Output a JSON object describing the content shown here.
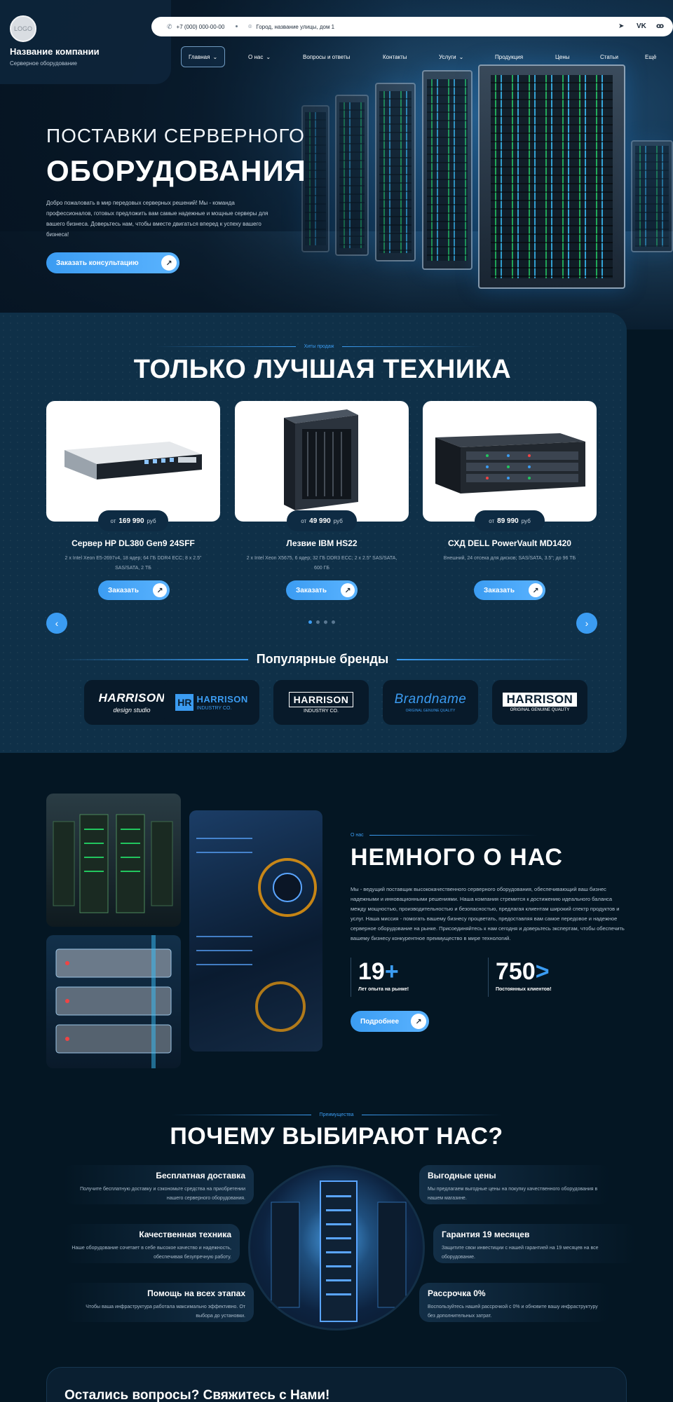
{
  "brand": {
    "logo_text": "LOGO",
    "company_name": "Название компании",
    "company_sub": "Серверное оборудование"
  },
  "topbar": {
    "phone": "+7 (000) 000-00-00",
    "address": "Город, название улицы, дом 1",
    "phone_icon": "phone-icon",
    "map_icon": "map-pin-icon",
    "social": [
      "telegram-icon",
      "vk-icon",
      "odnoklassniki-icon"
    ]
  },
  "nav": {
    "items": [
      "Главная",
      "О нас",
      "Вопросы и ответы",
      "Контакты",
      "Услуги",
      "Продукция",
      "Цены",
      "Статьи",
      "Ещё"
    ]
  },
  "hero": {
    "title_line1": "ПОСТАВКИ СЕРВЕРНОГО",
    "title_line2": "ОБОРУДОВАНИЯ",
    "description": "Добро пожаловать в мир передовых серверных решений! Мы - команда профессионалов, готовых предложить вам самые надежные и мощные серверы для вашего бизнеса. Доверьтесь нам, чтобы вместе двигаться вперед к успеху вашего бизнеса!",
    "cta": "Заказать консультацию"
  },
  "products": {
    "eyebrow": "Хиты продаж",
    "title": "ТОЛЬКО ЛУЧШАЯ ТЕХНИКА",
    "from_label": "от",
    "currency": "руб",
    "order_label": "Заказать",
    "items": [
      {
        "price": "169 990",
        "name": "Сервер HP DL380 Gen9 24SFF",
        "spec": "2 x Intel Xeon E5-2697v4, 18 ядер; 64 ГБ DDR4 ECC; 8 x 2.5\" SAS/SATA, 2 ТБ"
      },
      {
        "price": "49 990",
        "name": "Лезвие IBM HS22",
        "spec": "2 x Intel Xeon X5675, 6 ядер; 32 ГБ DDR3 ECC; 2 x 2.5\" SAS/SATA, 600 ГБ"
      },
      {
        "price": "89 990",
        "name": "СХД DELL PowerVault MD1420",
        "spec": "Внешний, 24 отсека для дисков; SAS/SATA, 3.5\"; до 96 ТБ"
      }
    ],
    "slide_count": 4,
    "active_slide": 1
  },
  "brands": {
    "title": "Популярные бренды",
    "items": [
      {
        "main": "HARRISON",
        "sub": "design studio"
      },
      {
        "main": "HARRISON",
        "sub": "INDUSTRY CO.",
        "badge": "HR"
      },
      {
        "main": "HARRISON",
        "sub": "INDUSTRY CO."
      },
      {
        "main": "Brandname",
        "sub": "ORIGINAL GENUINE QUALITY"
      },
      {
        "main": "HARRISON",
        "sub": "ORIGINAL GENUINE QUALITY"
      }
    ]
  },
  "about": {
    "eyebrow": "О нас",
    "title": "НЕМНОГО О НАС",
    "text": "Мы - ведущий поставщик высококачественного серверного оборудования, обеспечивающий ваш бизнес надежными и инновационными решениями. Наша компания стремится к достижению идеального баланса между мощностью, производительностью и безопасностью, предлагая клиентам широкий спектр продуктов и услуг. Наша миссия - помогать вашему бизнесу процветать, предоставляя вам самое передовое и надежное серверное оборудование на рынке. Присоединяйтесь к нам сегодня и доверьтесь экспертам, чтобы обеспечить вашему бизнесу конкурентное преимущество в мире технологий.",
    "stats": [
      {
        "value": "19",
        "suffix": "+",
        "label": "Лет опыта на рынке!"
      },
      {
        "value": "750",
        "suffix": ">",
        "label": "Постоянных клиентов!"
      }
    ],
    "more": "Подробнее"
  },
  "why": {
    "eyebrow": "Преимущества",
    "title": "ПОЧЕМУ ВЫБИРАЮТ НАС?",
    "left": [
      {
        "title": "Бесплатная доставка",
        "text": "Получите бесплатную доставку и сэкономьте средства на приобретении нашего серверного оборудования."
      },
      {
        "title": "Качественная техника",
        "text": "Наше оборудование сочетает в себе высокое качество и надежность, обеспечивая безупречную работу."
      },
      {
        "title": "Помощь на всех этапах",
        "text": "Чтобы ваша инфраструктура работала максимально эффективно. От выбора до установки."
      }
    ],
    "right": [
      {
        "title": "Выгодные цены",
        "text": "Мы предлагаем выгодные цены на покупку качественного оборудования в нашем магазине."
      },
      {
        "title": "Гарантия 19 месяцев",
        "text": "Защитите свои инвестиции с нашей гарантией на 19 месяцев на все оборудование."
      },
      {
        "title": "Рассрочка 0%",
        "text": "Воспользуйтесь нашей рассрочкой с 0% и обновите вашу инфраструктуру без дополнительных затрат."
      }
    ]
  },
  "contact": {
    "title": "Остались вопросы? Свяжитесь с Нами!"
  }
}
